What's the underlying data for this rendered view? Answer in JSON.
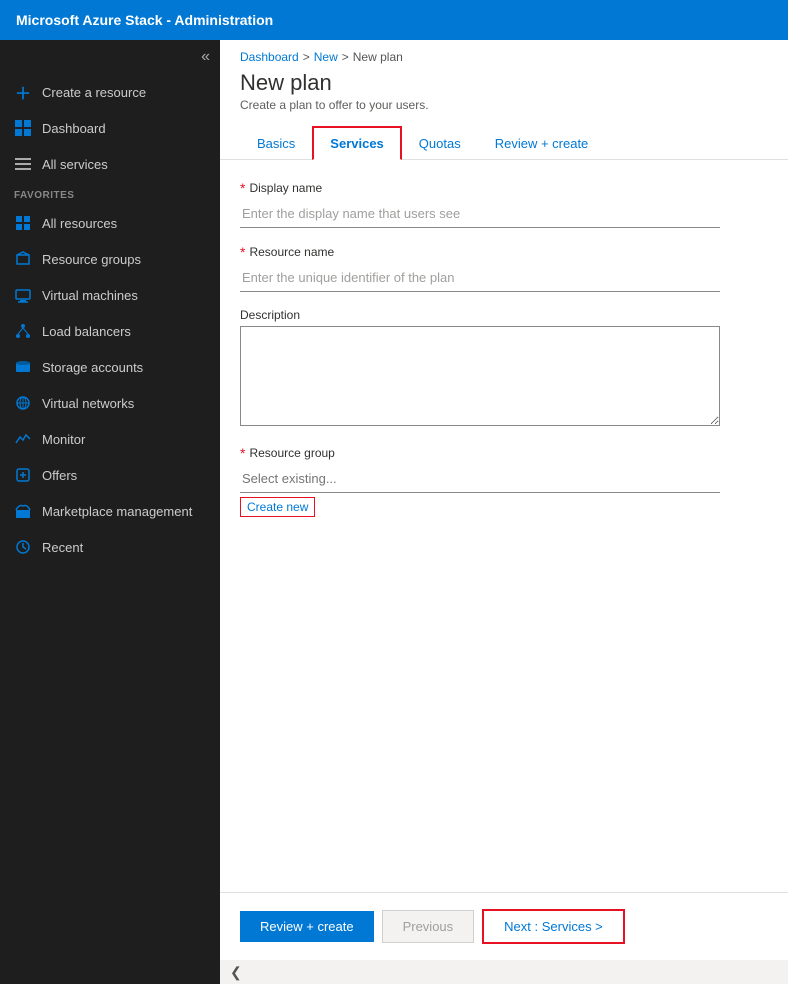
{
  "topbar": {
    "title": "Microsoft Azure Stack - Administration"
  },
  "sidebar": {
    "collapse_icon": "«",
    "items": [
      {
        "id": "create-resource",
        "label": "Create a resource",
        "icon": "plus-icon"
      },
      {
        "id": "dashboard",
        "label": "Dashboard",
        "icon": "dashboard-icon"
      },
      {
        "id": "all-services",
        "label": "All services",
        "icon": "list-icon"
      }
    ],
    "section_label": "FAVORITES",
    "favorites": [
      {
        "id": "all-resources",
        "label": "All resources",
        "icon": "resources-icon"
      },
      {
        "id": "resource-groups",
        "label": "Resource groups",
        "icon": "groups-icon"
      },
      {
        "id": "virtual-machines",
        "label": "Virtual machines",
        "icon": "vm-icon"
      },
      {
        "id": "load-balancers",
        "label": "Load balancers",
        "icon": "lb-icon"
      },
      {
        "id": "storage-accounts",
        "label": "Storage accounts",
        "icon": "storage-icon"
      },
      {
        "id": "virtual-networks",
        "label": "Virtual networks",
        "icon": "vnet-icon"
      },
      {
        "id": "monitor",
        "label": "Monitor",
        "icon": "monitor-icon"
      },
      {
        "id": "offers",
        "label": "Offers",
        "icon": "offers-icon"
      },
      {
        "id": "marketplace-management",
        "label": "Marketplace management",
        "icon": "marketplace-icon"
      },
      {
        "id": "recent",
        "label": "Recent",
        "icon": "recent-icon"
      }
    ]
  },
  "breadcrumb": {
    "items": [
      "Dashboard",
      "New",
      "New plan"
    ]
  },
  "page": {
    "title": "New plan",
    "subtitle": "Create a plan to offer to your users."
  },
  "tabs": [
    {
      "id": "basics",
      "label": "Basics",
      "active": false
    },
    {
      "id": "services",
      "label": "Services",
      "active": true
    },
    {
      "id": "quotas",
      "label": "Quotas",
      "active": false
    },
    {
      "id": "review-create",
      "label": "Review + create",
      "active": false
    }
  ],
  "form": {
    "display_name_label": "Display name",
    "display_name_placeholder": "Enter the display name that users see",
    "resource_name_label": "Resource name",
    "resource_name_placeholder": "Enter the unique identifier of the plan",
    "description_label": "Description",
    "resource_group_label": "Resource group",
    "resource_group_placeholder": "Select existing...",
    "create_new_label": "Create new",
    "required_marker": "*"
  },
  "footer": {
    "review_create_label": "Review + create",
    "previous_label": "Previous",
    "next_label": "Next : Services >"
  },
  "bottom_bar": {
    "collapse_icon": "❮"
  }
}
